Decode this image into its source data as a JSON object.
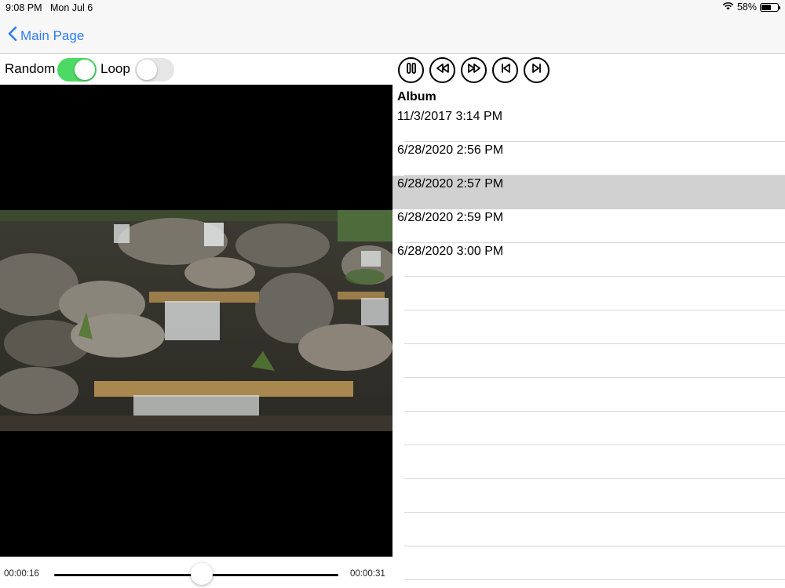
{
  "status_bar": {
    "time": "9:08 PM",
    "date": "Mon Jul 6",
    "battery_percent": "58%",
    "battery_level": 0.58
  },
  "nav": {
    "back_label": "Main Page",
    "accent_color": "#2f7df6"
  },
  "toggles": {
    "random": {
      "label": "Random",
      "on": true
    },
    "loop": {
      "label": "Loop",
      "on": false
    }
  },
  "player": {
    "elapsed": "00:00:16",
    "duration": "00:00:31",
    "progress": 0.52,
    "controls": [
      "pause-icon",
      "rewind-icon",
      "fast-forward-icon",
      "previous-track-icon",
      "next-track-icon"
    ]
  },
  "album": {
    "header": "Album",
    "items": [
      "11/3/2017 3:14 PM",
      "6/28/2020 2:56 PM",
      "6/28/2020 2:57 PM",
      "6/28/2020 2:59 PM",
      "6/28/2020 3:00 PM"
    ],
    "selected_index": 2
  }
}
